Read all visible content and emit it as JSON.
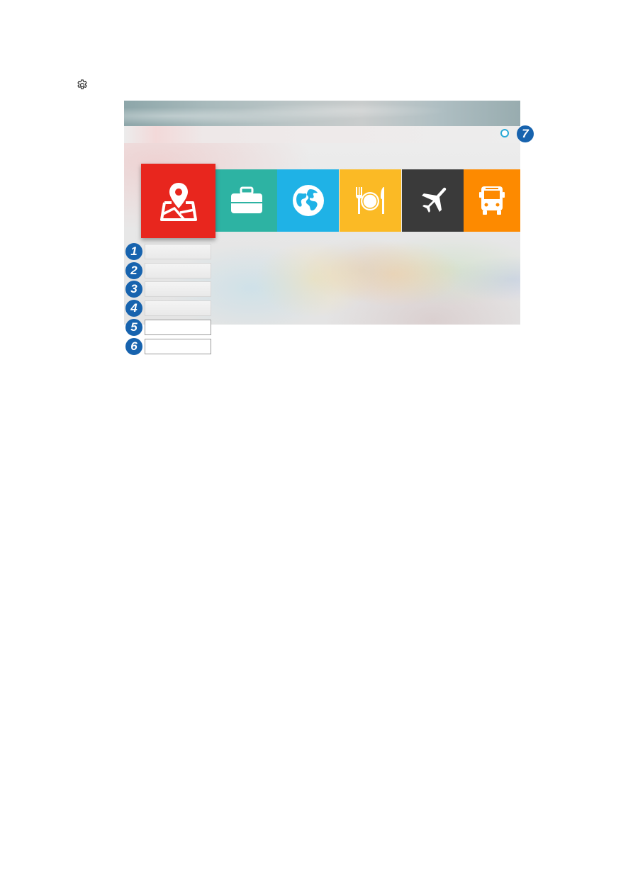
{
  "page": {
    "settings_icon": "gear-icon"
  },
  "screen": {
    "categories": [
      {
        "icon": "map-pin-icon",
        "color": "#e8261e",
        "selected": true
      },
      {
        "icon": "briefcase-icon",
        "color": "#2db3a3"
      },
      {
        "icon": "globe-icon",
        "color": "#1fb2e6"
      },
      {
        "icon": "dining-icon",
        "color": "#fbba25"
      },
      {
        "icon": "airplane-icon",
        "color": "#3a3a3a"
      },
      {
        "icon": "bus-icon",
        "color": "#fd8a00"
      }
    ],
    "menu_items": [
      {
        "label": "",
        "style": "grey"
      },
      {
        "label": "",
        "style": "grey"
      },
      {
        "label": "",
        "style": "grey"
      },
      {
        "label": "",
        "style": "grey"
      },
      {
        "label": "",
        "style": "white"
      },
      {
        "label": "",
        "style": "white"
      }
    ]
  },
  "callouts": [
    "1",
    "2",
    "3",
    "4",
    "5",
    "6",
    "7"
  ],
  "colors": {
    "callout": "#1763ae",
    "indicator_ring": "#29a9d6"
  }
}
